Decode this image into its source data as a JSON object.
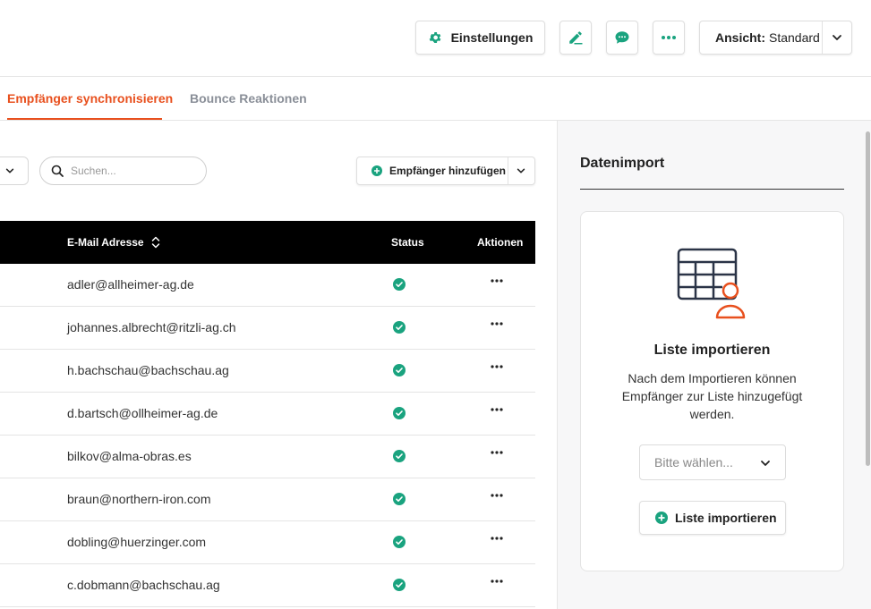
{
  "toolbar": {
    "settings_label": "Einstellungen",
    "view_label": "Ansicht:",
    "view_value": "Standard",
    "icons": {
      "settings": "gear-icon",
      "edit": "pen-icon",
      "chat": "chat-bubble-icon",
      "more": "more-dots-icon",
      "view_dropdown": "chevron-down-icon"
    }
  },
  "tabs": [
    {
      "label": "Empfänger synchronisieren",
      "active": true
    },
    {
      "label": "Bounce Reaktionen",
      "active": false
    }
  ],
  "search": {
    "placeholder": "Suchen..."
  },
  "add_button": {
    "label": "Empfänger hinzufügen"
  },
  "table": {
    "columns": {
      "email": "E-Mail Adresse",
      "status": "Status",
      "actions": "Aktionen"
    },
    "rows": [
      {
        "email": "adler@allheimer-ag.de"
      },
      {
        "email": "johannes.albrecht@ritzli-ag.ch"
      },
      {
        "email": "h.bachschau@bachschau.ag"
      },
      {
        "email": "d.bartsch@ollheimer-ag.de"
      },
      {
        "email": "bilkov@alma-obras.es"
      },
      {
        "email": "braun@northern-iron.com"
      },
      {
        "email": "dobling@huerzinger.com"
      },
      {
        "email": "c.dobmann@bachschau.ag"
      }
    ]
  },
  "import_panel": {
    "title": "Datenimport",
    "card_title": "Liste importieren",
    "card_text": "Nach dem Importieren können Empfänger zur Liste hinzugefügt werden.",
    "select_placeholder": "Bitte wählen...",
    "button_label": "Liste importieren"
  },
  "colors": {
    "accent": "#e8501e",
    "green": "#1aa37f",
    "header_bg": "#000000"
  }
}
